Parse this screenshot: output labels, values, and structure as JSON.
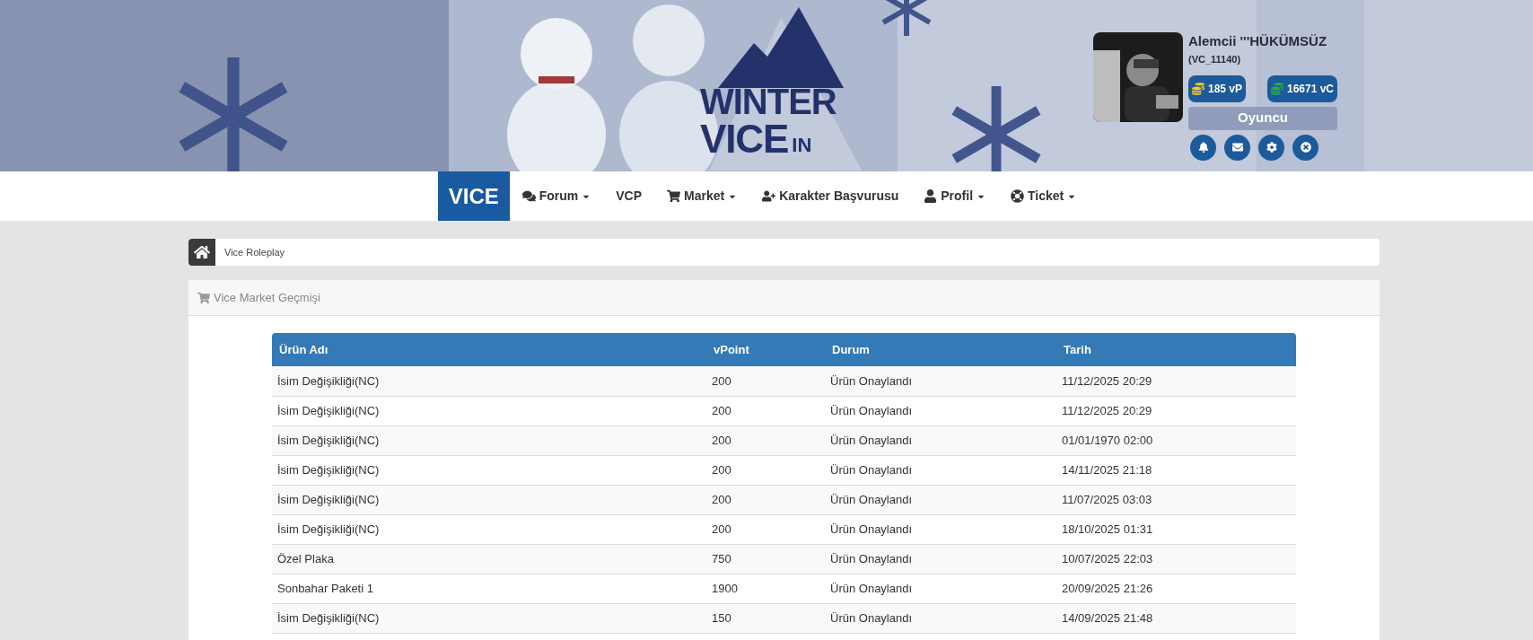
{
  "logo": {
    "line_1": "WINTER",
    "line_2": "VICE",
    "line_3": "IN"
  },
  "user": {
    "name": "Alemcii '''HÜKÜMSÜZ",
    "id": "(VC_11140)",
    "vpoints": "185 vP",
    "vcoins": "16671 vC",
    "role": "Oyuncu"
  },
  "nav": {
    "brand": "VICE",
    "items": [
      {
        "label": "Forum",
        "dropdown": true
      },
      {
        "label": "VCP",
        "dropdown": false
      },
      {
        "label": "Market",
        "dropdown": true
      },
      {
        "label": "Karakter Başvurusu",
        "dropdown": false
      },
      {
        "label": "Profil",
        "dropdown": true
      },
      {
        "label": "Ticket",
        "dropdown": true
      }
    ]
  },
  "breadcrumb": [
    "Vice Roleplay"
  ],
  "panel": {
    "title": "Vice Market Geçmişi"
  },
  "table": {
    "columns": [
      "Ürün Adı",
      "vPoint",
      "Durum",
      "Tarih"
    ],
    "rows": [
      [
        "İsim Değişikliği(NC)",
        "200",
        "Ürün Onaylandı",
        "11/12/2025 20:29"
      ],
      [
        "İsim Değişikliği(NC)",
        "200",
        "Ürün Onaylandı",
        "11/12/2025 20:29"
      ],
      [
        "İsim Değişikliği(NC)",
        "200",
        "Ürün Onaylandı",
        "01/01/1970 02:00"
      ],
      [
        "İsim Değişikliği(NC)",
        "200",
        "Ürün Onaylandı",
        "14/11/2025 21:18"
      ],
      [
        "İsim Değişikliği(NC)",
        "200",
        "Ürün Onaylandı",
        "11/07/2025 03:03"
      ],
      [
        "İsim Değişikliği(NC)",
        "200",
        "Ürün Onaylandı",
        "18/10/2025 01:31"
      ],
      [
        "Özel Plaka",
        "750",
        "Ürün Onaylandı",
        "10/07/2025 22:03"
      ],
      [
        "Sonbahar Paketi 1",
        "1900",
        "Ürün Onaylandı",
        "20/09/2025 21:26"
      ],
      [
        "İsim Değişikliği(NC)",
        "150",
        "Ürün Onaylandı",
        "14/09/2025 21:48"
      ]
    ]
  }
}
